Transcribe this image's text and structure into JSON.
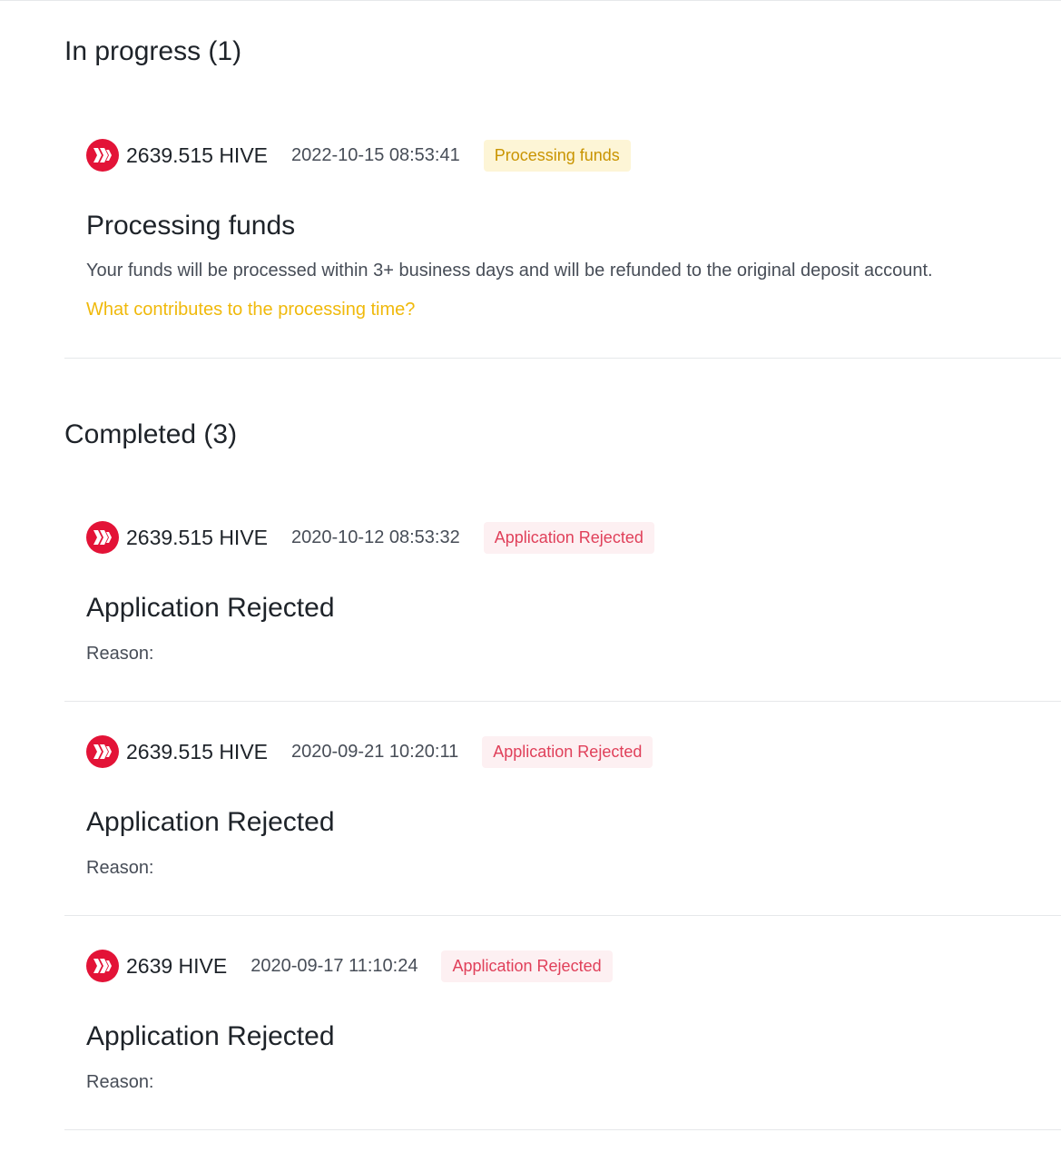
{
  "colors": {
    "hive_red": "#e31337",
    "processing_bg": "#fdf5d6",
    "processing_text": "#c99400",
    "rejected_bg": "#fdf0f2",
    "rejected_text": "#e0405a",
    "link": "#f0b90b"
  },
  "in_progress": {
    "title": "In progress (1)",
    "items": [
      {
        "icon": "hive-icon",
        "amount": "2639.515 HIVE",
        "timestamp": "2022-10-15 08:53:41",
        "badge": "Processing funds",
        "status_title": "Processing funds",
        "description": "Your funds will be processed within 3+ business days and will be refunded to the original deposit account.",
        "link": "What contributes to the processing time?"
      }
    ]
  },
  "completed": {
    "title": "Completed (3)",
    "items": [
      {
        "icon": "hive-icon",
        "amount": "2639.515 HIVE",
        "timestamp": "2020-10-12 08:53:32",
        "badge": "Application Rejected",
        "status_title": "Application Rejected",
        "reason_label": "Reason:"
      },
      {
        "icon": "hive-icon",
        "amount": "2639.515 HIVE",
        "timestamp": "2020-09-21 10:20:11",
        "badge": "Application Rejected",
        "status_title": "Application Rejected",
        "reason_label": "Reason:"
      },
      {
        "icon": "hive-icon",
        "amount": "2639 HIVE",
        "timestamp": "2020-09-17 11:10:24",
        "badge": "Application Rejected",
        "status_title": "Application Rejected",
        "reason_label": "Reason:"
      }
    ]
  }
}
